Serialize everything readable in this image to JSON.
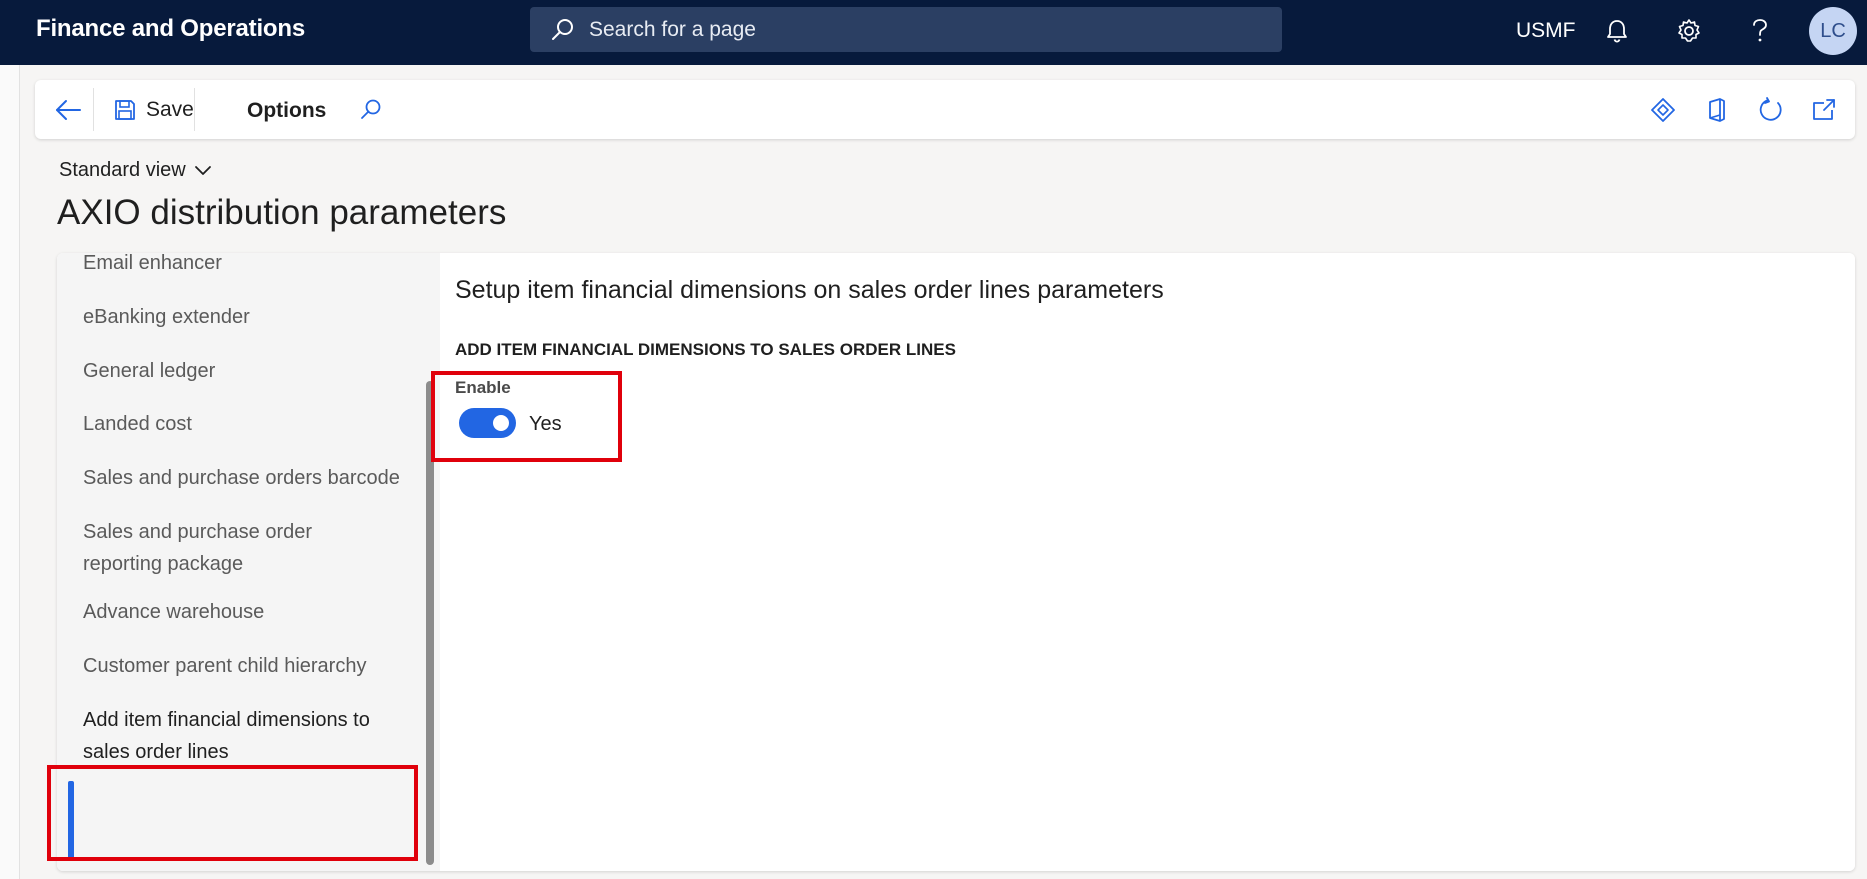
{
  "header": {
    "app_title": "Finance and Operations",
    "search_placeholder": "Search for a page",
    "company": "USMF",
    "avatar_initials": "LC",
    "background": "#071a3c"
  },
  "actionbar": {
    "save_label": "Save",
    "options_label": "Options"
  },
  "view": {
    "label": "Standard view"
  },
  "page": {
    "title": "AXIO distribution parameters"
  },
  "nav": {
    "items": [
      {
        "label": "Email enhancer"
      },
      {
        "label": "eBanking extender"
      },
      {
        "label": "General ledger"
      },
      {
        "label": "Landed cost"
      },
      {
        "label": "Sales and purchase orders barcode"
      },
      {
        "label": "Sales and purchase order reporting package"
      },
      {
        "label": "Advance warehouse"
      },
      {
        "label": "Customer parent child hierarchy"
      },
      {
        "label": "Add item financial dimensions to sales order lines",
        "selected": true
      }
    ]
  },
  "detail": {
    "section_title": "Setup item financial dimensions on sales order lines parameters",
    "group_title": "ADD ITEM FINANCIAL DIMENSIONS TO SALES ORDER LINES",
    "enable": {
      "label": "Enable",
      "value": "Yes",
      "on": true
    }
  },
  "colors": {
    "accent": "#2266e3",
    "highlight": "#e0000b"
  }
}
